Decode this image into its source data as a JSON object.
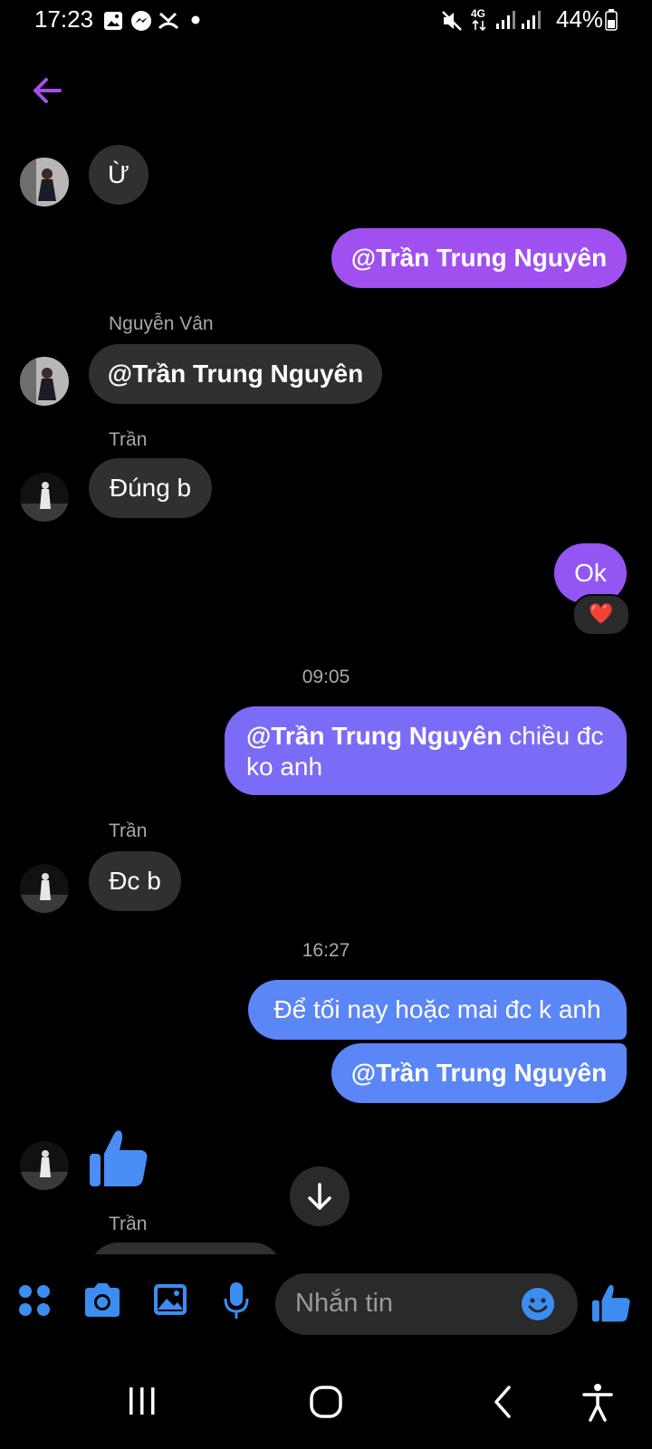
{
  "status_bar": {
    "time": "17:23",
    "battery": "44%",
    "network": "4G"
  },
  "header": {
    "back_icon": "arrow-left-icon",
    "accent": "#a350e8"
  },
  "messages": {
    "m1": {
      "text": "Ừ"
    },
    "m2": {
      "text": "@Trần Trung Nguyên"
    },
    "m3": {
      "sender": "Nguyễn Vân",
      "text": "@Trần Trung Nguyên"
    },
    "m4": {
      "sender": "Trần",
      "text": "Đúng b"
    },
    "m5": {
      "text": "Ok",
      "reaction": "❤️"
    },
    "stamp1": "09:05",
    "m6": {
      "mention": "@Trần Trung Nguyên",
      "text": " chiều đc ko anh"
    },
    "m7": {
      "sender": "Trần",
      "text": "Đc b"
    },
    "stamp2": "16:27",
    "m8": {
      "text": "Để tối nay hoặc mai đc k anh"
    },
    "m9": {
      "text": "@Trần Trung Nguyên"
    },
    "m10": {
      "icon": "thumbs-up-icon"
    },
    "m11": {
      "sender": "Trần"
    }
  },
  "composer": {
    "placeholder": "Nhắn tin",
    "accent": "#3b8df0"
  },
  "colors": {
    "outgoing_purple": "#a050f0",
    "outgoing_violet": "#7a6cf6",
    "outgoing_blue": "#5b86f5",
    "incoming": "#303030"
  }
}
